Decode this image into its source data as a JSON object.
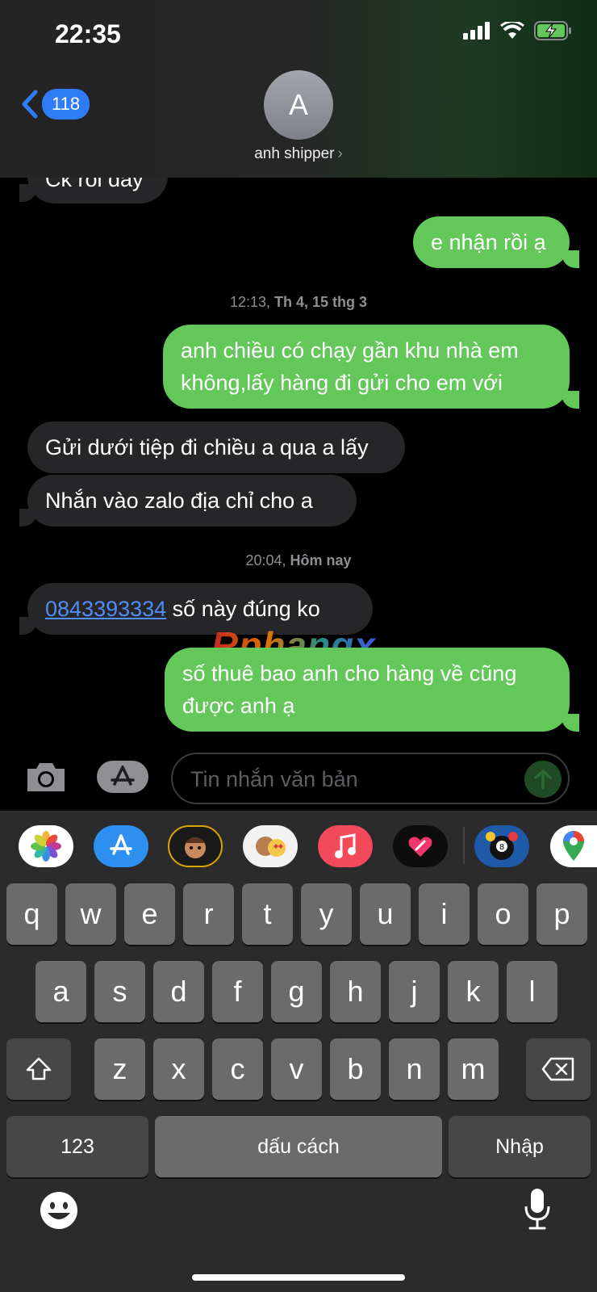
{
  "status_bar": {
    "time": "22:35"
  },
  "header": {
    "back_count": "118",
    "avatar_initial": "A",
    "contact_name": "anh shipper"
  },
  "messages": {
    "m0": "Ck rồi đấy",
    "m1": "e nhận rồi ạ",
    "ts1_prefix": "12:13, ",
    "ts1_bold": "Th 4, 15 thg 3",
    "m2_line1": "anh chiều có chạy gần khu nhà em",
    "m2_line2": "không,lấy hàng đi gửi cho em với",
    "m3": "Gửi dưới tiệp đi chiều a qua a lấy",
    "m4": "Nhắn vào zalo địa chỉ cho a",
    "ts2_prefix": "20:04, ",
    "ts2_bold": "Hôm nay",
    "m5_link": "0843393334",
    "m5_rest": " số này đúng ko",
    "m6_line1": "số thuê bao anh cho hàng về cũng",
    "m6_line2": "được anh ạ"
  },
  "watermark": "Rphangx",
  "input": {
    "placeholder": "Tin nhắn văn bản"
  },
  "keyboard": {
    "row1": [
      "q",
      "w",
      "e",
      "r",
      "t",
      "y",
      "u",
      "i",
      "o",
      "p"
    ],
    "row2": [
      "a",
      "s",
      "d",
      "f",
      "g",
      "h",
      "j",
      "k",
      "l"
    ],
    "row3": [
      "z",
      "x",
      "c",
      "v",
      "b",
      "n",
      "m"
    ],
    "numbers_key": "123",
    "space_key": "dấu cách",
    "return_key": "Nhập"
  },
  "app_strip": [
    "photos-app",
    "app-store-app",
    "memoji-app",
    "animoji-app",
    "music-app",
    "digital-touch-app",
    "8-ball-pool-app",
    "google-maps-app"
  ],
  "colors": {
    "outgoing_bubble": "#63c75a",
    "incoming_bubble": "#262628",
    "accent_blue": "#2f7cf6"
  }
}
